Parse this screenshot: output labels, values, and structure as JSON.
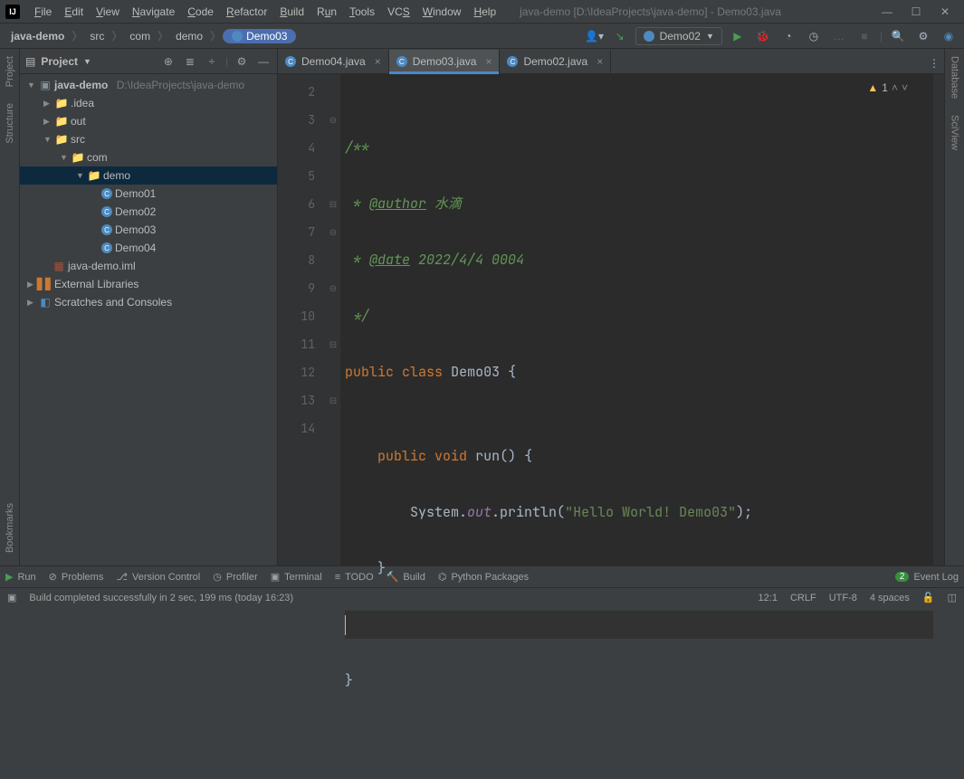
{
  "title": "java-demo [D:\\IdeaProjects\\java-demo] - Demo03.java",
  "menu": [
    "File",
    "Edit",
    "View",
    "Navigate",
    "Code",
    "Refactor",
    "Build",
    "Run",
    "Tools",
    "VCS",
    "Window",
    "Help"
  ],
  "breadcrumb": [
    "java-demo",
    "src",
    "com",
    "demo",
    "Demo03"
  ],
  "run_config": "Demo02",
  "project": {
    "title": "Project",
    "root": {
      "name": "java-demo",
      "path": "D:\\IdeaProjects\\java-demo"
    },
    "idea": ".idea",
    "out": "out",
    "src": "src",
    "com": "com",
    "demo": "demo",
    "files": [
      "Demo01",
      "Demo02",
      "Demo03",
      "Demo04"
    ],
    "iml": "java-demo.iml",
    "ext": "External Libraries",
    "scratches": "Scratches and Consoles"
  },
  "tabs": [
    {
      "name": "Demo04.java",
      "active": false
    },
    {
      "name": "Demo03.java",
      "active": true
    },
    {
      "name": "Demo02.java",
      "active": false
    }
  ],
  "warning_count": "1",
  "code": {
    "line2": "",
    "line3": "/**",
    "line4a": " * ",
    "line4b": "@author",
    "line4c": " 水滴",
    "line5a": " * ",
    "line5b": "@date",
    "line5c": " 2022/4/4 0004",
    "line6": " */",
    "line7a": "public",
    "line7b": "class",
    "line7c": "Demo03",
    "line7d": "{",
    "line8": "",
    "line9a": "public",
    "line9b": "void",
    "line9c": "run",
    "line9d": "() {",
    "line10a": "System.",
    "line10b": "out",
    "line10c": ".println(",
    "line10d": "\"Hello World! Demo03\"",
    "line10e": ");",
    "line11": "}",
    "line12": "",
    "line13": "}",
    "line14": ""
  },
  "line_numbers": [
    "2",
    "3",
    "4",
    "5",
    "6",
    "7",
    "8",
    "9",
    "10",
    "11",
    "12",
    "13",
    "14"
  ],
  "tool_windows": [
    "Run",
    "Problems",
    "Version Control",
    "Profiler",
    "Terminal",
    "TODO",
    "Build",
    "Python Packages"
  ],
  "event_log": {
    "count": "2",
    "label": "Event Log"
  },
  "side_left": [
    "Project",
    "Structure",
    "Bookmarks"
  ],
  "side_right": [
    "Database",
    "SciView"
  ],
  "status": {
    "msg": "Build completed successfully in 2 sec, 199 ms (today 16:23)",
    "pos": "12:1",
    "eol": "CRLF",
    "enc": "UTF-8",
    "indent": "4 spaces"
  }
}
